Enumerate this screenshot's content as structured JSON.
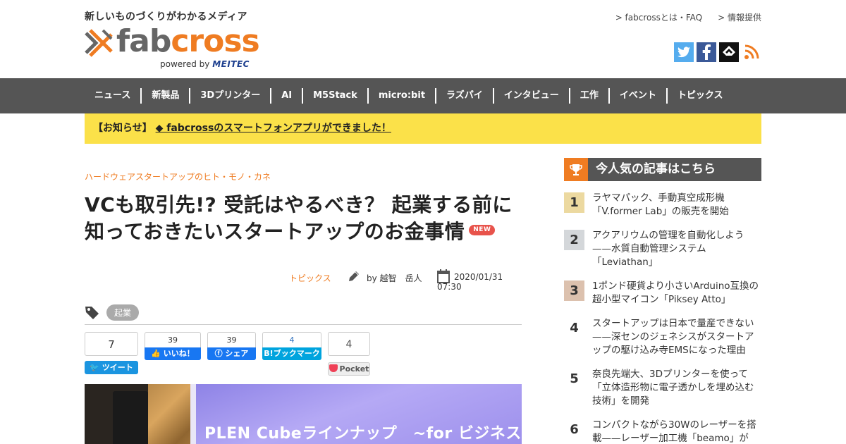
{
  "header": {
    "tagline": "新しいものづくりがわかるメディア",
    "logo_fab": "fab",
    "logo_cross": "cross",
    "logo_powered": "powered by",
    "logo_meitec": "MEITEC",
    "top_links": [
      "> fabcrossとは・FAQ",
      "> 情報提供"
    ],
    "social": {
      "twitter": "twitter-icon",
      "facebook": "facebook-icon",
      "feedly": "feedly-icon",
      "rss": "rss-icon"
    },
    "colors": {
      "accent": "#ef7c22",
      "twitter": "#55acee",
      "facebook": "#3b5998",
      "nav": "#555555",
      "notice": "#fbe149"
    }
  },
  "nav": {
    "items": [
      "ニュース",
      "新製品",
      "3Dプリンター",
      "AI",
      "M5Stack",
      "micro:bit",
      "ラズパイ",
      "インタビュー",
      "工作",
      "イベント",
      "トピックス"
    ]
  },
  "notice": {
    "prefix": "【お知らせ】",
    "link": "◆ fabcrossのスマートフォンアプリができました！"
  },
  "article": {
    "category": "ハードウェアスタートアップのヒト・モノ・カネ",
    "title_line1": "VCも取引先!? 受託はやるべき？ 起業する前に",
    "title_line2": "知っておきたいスタートアップのお金事情",
    "badge": "NEW",
    "meta_category": "トピックス",
    "author": "by 越智　岳人",
    "date": "2020/01/31 07:30",
    "tag": "起業"
  },
  "share": {
    "tweet_count": "7",
    "tweet_label": "ツイート",
    "like_count": "39",
    "like_label": "いいね！",
    "fb_share_count": "39",
    "fb_share_label": "シェア",
    "hatena_count": "4",
    "hatena_label": "B!ブックマーク",
    "pocket_count": "4",
    "pocket_label": "Pocket"
  },
  "hero": {
    "screen_text": "PLEN Cubeラインナップ　~for ビジネス~"
  },
  "sidebar": {
    "heading": "今人気の記事はこちら",
    "ranking": [
      {
        "num": "1",
        "text": "ラヤマパック、手動真空成形機「V.former Lab」の販売を開始"
      },
      {
        "num": "2",
        "text": "アクアリウムの管理を自動化しよう——水質自動管理システム「Leviathan」"
      },
      {
        "num": "3",
        "text": "1ポンド硬貨より小さいArduino互換の超小型マイコン「Piksey Atto」"
      },
      {
        "num": "4",
        "text": "スタートアップは日本で量産できない——深センのジェネシスがスタートアップの駆け込み寺EMSになった理由"
      },
      {
        "num": "5",
        "text": "奈良先端大、3Dプリンターを使って「立体造形物に電子透かしを埋め込む技術」を開発"
      },
      {
        "num": "6",
        "text": "コンパクトながら30Wのレーザーを搭載——レーザー加工機「beamo」が"
      }
    ]
  }
}
